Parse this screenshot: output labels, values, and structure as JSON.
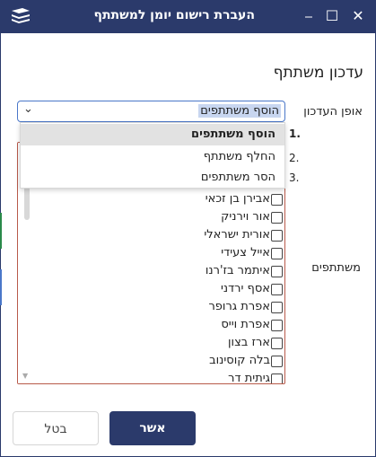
{
  "window": {
    "title": "העברת רישום יומן למשתתף",
    "minimize_glyph": "⎯",
    "maximize_glyph": "☐",
    "close_glyph": "✕",
    "accent_color": "#2b3a6b"
  },
  "form": {
    "section_title": "עדכון משתתף",
    "mode_label": "אופן העדכון",
    "participants_label": "משתתפים",
    "mode_select": {
      "selected": "הוסף משתתפים",
      "options": [
        "הוסף משתתפים",
        "החלף משתתף",
        "הסר משתתפים"
      ]
    },
    "numbers": [
      "1.",
      "2.",
      "3."
    ],
    "participants": [
      "אבירן בן זכאי",
      "אור וירניק",
      "אורית ישראלי",
      "אייל צעידי",
      "איתמר בז'רנו",
      "אסף ירדני",
      "אפרת גרופר",
      "אפרת וייס",
      "ארז בצון",
      "בלה קוסינוב",
      "גיתית דר"
    ]
  },
  "buttons": {
    "ok": "אשר",
    "cancel": "בטל"
  }
}
